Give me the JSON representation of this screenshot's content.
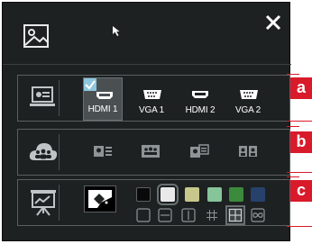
{
  "sources": [
    {
      "label": "HDMI 1",
      "selected": true,
      "kind": "hdmi"
    },
    {
      "label": "VGA 1",
      "selected": false,
      "kind": "vga"
    },
    {
      "label": "HDMI 2",
      "selected": false,
      "kind": "hdmi"
    },
    {
      "label": "VGA 2",
      "selected": false,
      "kind": "vga"
    }
  ],
  "callouts": {
    "a": "a",
    "b": "b",
    "c": "c"
  },
  "layouts": [
    "presenter-with-list",
    "group",
    "presenter-with-slide",
    "two-people"
  ],
  "swatches": [
    {
      "color": "#0a0a0a",
      "selected": false
    },
    {
      "color": "#e9e9e9",
      "selected": true
    },
    {
      "color": "#c7c78b",
      "selected": false
    },
    {
      "color": "#86c49a",
      "selected": false
    },
    {
      "color": "#3c8a3c",
      "selected": false
    },
    {
      "color": "#27416b",
      "selected": false
    }
  ],
  "patterns": [
    "blank",
    "lines-horizontal",
    "lines-vertical",
    "grid-fine",
    "grid-coarse",
    "infinity"
  ],
  "pattern_selected": 4,
  "colors": {
    "accent_red": "#d81a2a",
    "panel_bg": "#1e2122",
    "check": "#8ec6df",
    "icon": "#bfc4c6"
  }
}
